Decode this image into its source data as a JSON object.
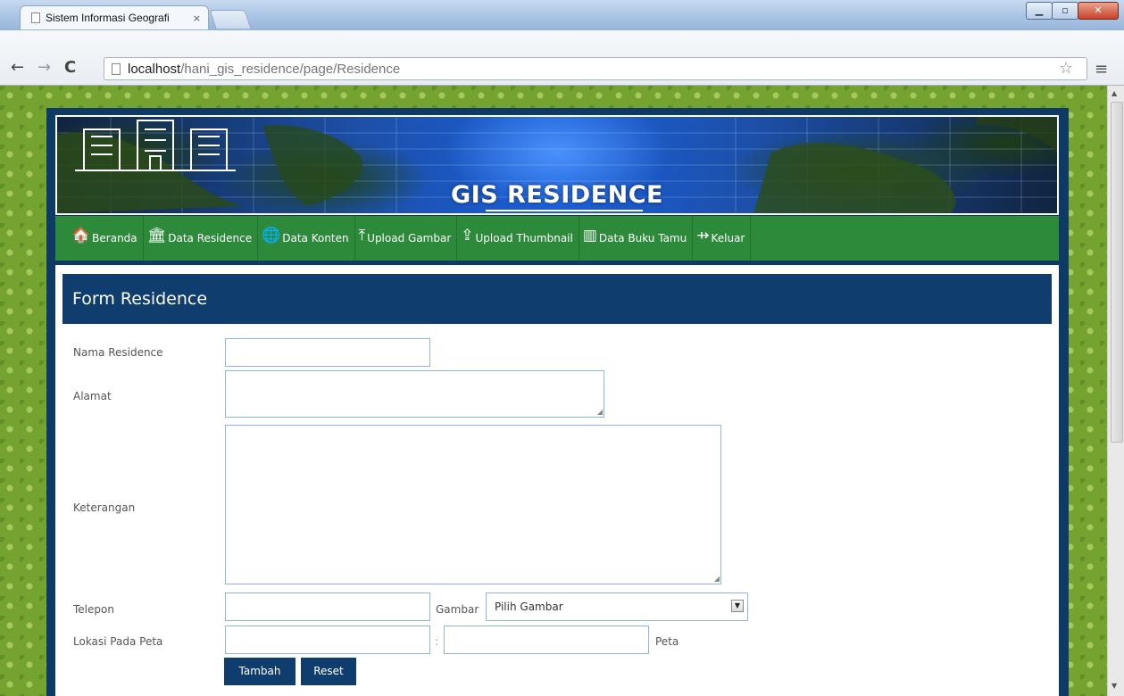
{
  "browser": {
    "tab_title": "Sistem Informasi Geografi",
    "tab_close": "×",
    "url_host": "localhost",
    "url_path": "/hani_gis_residence/page/Residence"
  },
  "banner": {
    "title": "GIS RESIDENCE"
  },
  "nav": {
    "items": [
      {
        "label": "Beranda",
        "icon": "home-icon",
        "glyph": "🏠"
      },
      {
        "label": "Data Residence",
        "icon": "institution-icon",
        "glyph": "🏛"
      },
      {
        "label": "Data Konten",
        "icon": "globe-icon",
        "glyph": "🌐"
      },
      {
        "label": "Upload Gambar",
        "icon": "cloud-upload-icon",
        "glyph": "⤒"
      },
      {
        "label": "Upload Thumbnail",
        "icon": "upload-icon",
        "glyph": "⇪"
      },
      {
        "label": "Data Buku Tamu",
        "icon": "book-icon",
        "glyph": "▥"
      },
      {
        "label": "Keluar",
        "icon": "logout-icon",
        "glyph": "⇸"
      }
    ]
  },
  "form": {
    "title": "Form Residence",
    "labels": {
      "nama": "Nama Residence",
      "alamat": "Alamat",
      "keterangan": "Keterangan",
      "telepon": "Telepon",
      "gambar": "Gambar",
      "lokasi": "Lokasi Pada Peta",
      "separator": ":",
      "peta": "Peta"
    },
    "values": {
      "nama": "",
      "alamat": "",
      "keterangan": "",
      "telepon": "",
      "lat": "",
      "lng": ""
    },
    "select": {
      "selected": "Pilih Gambar"
    },
    "buttons": {
      "submit": "Tambah",
      "reset": "Reset"
    }
  },
  "colors": {
    "navy": "#0e3d6e",
    "green_nav": "#2c8a3a",
    "page_bg": "#74a42f"
  }
}
